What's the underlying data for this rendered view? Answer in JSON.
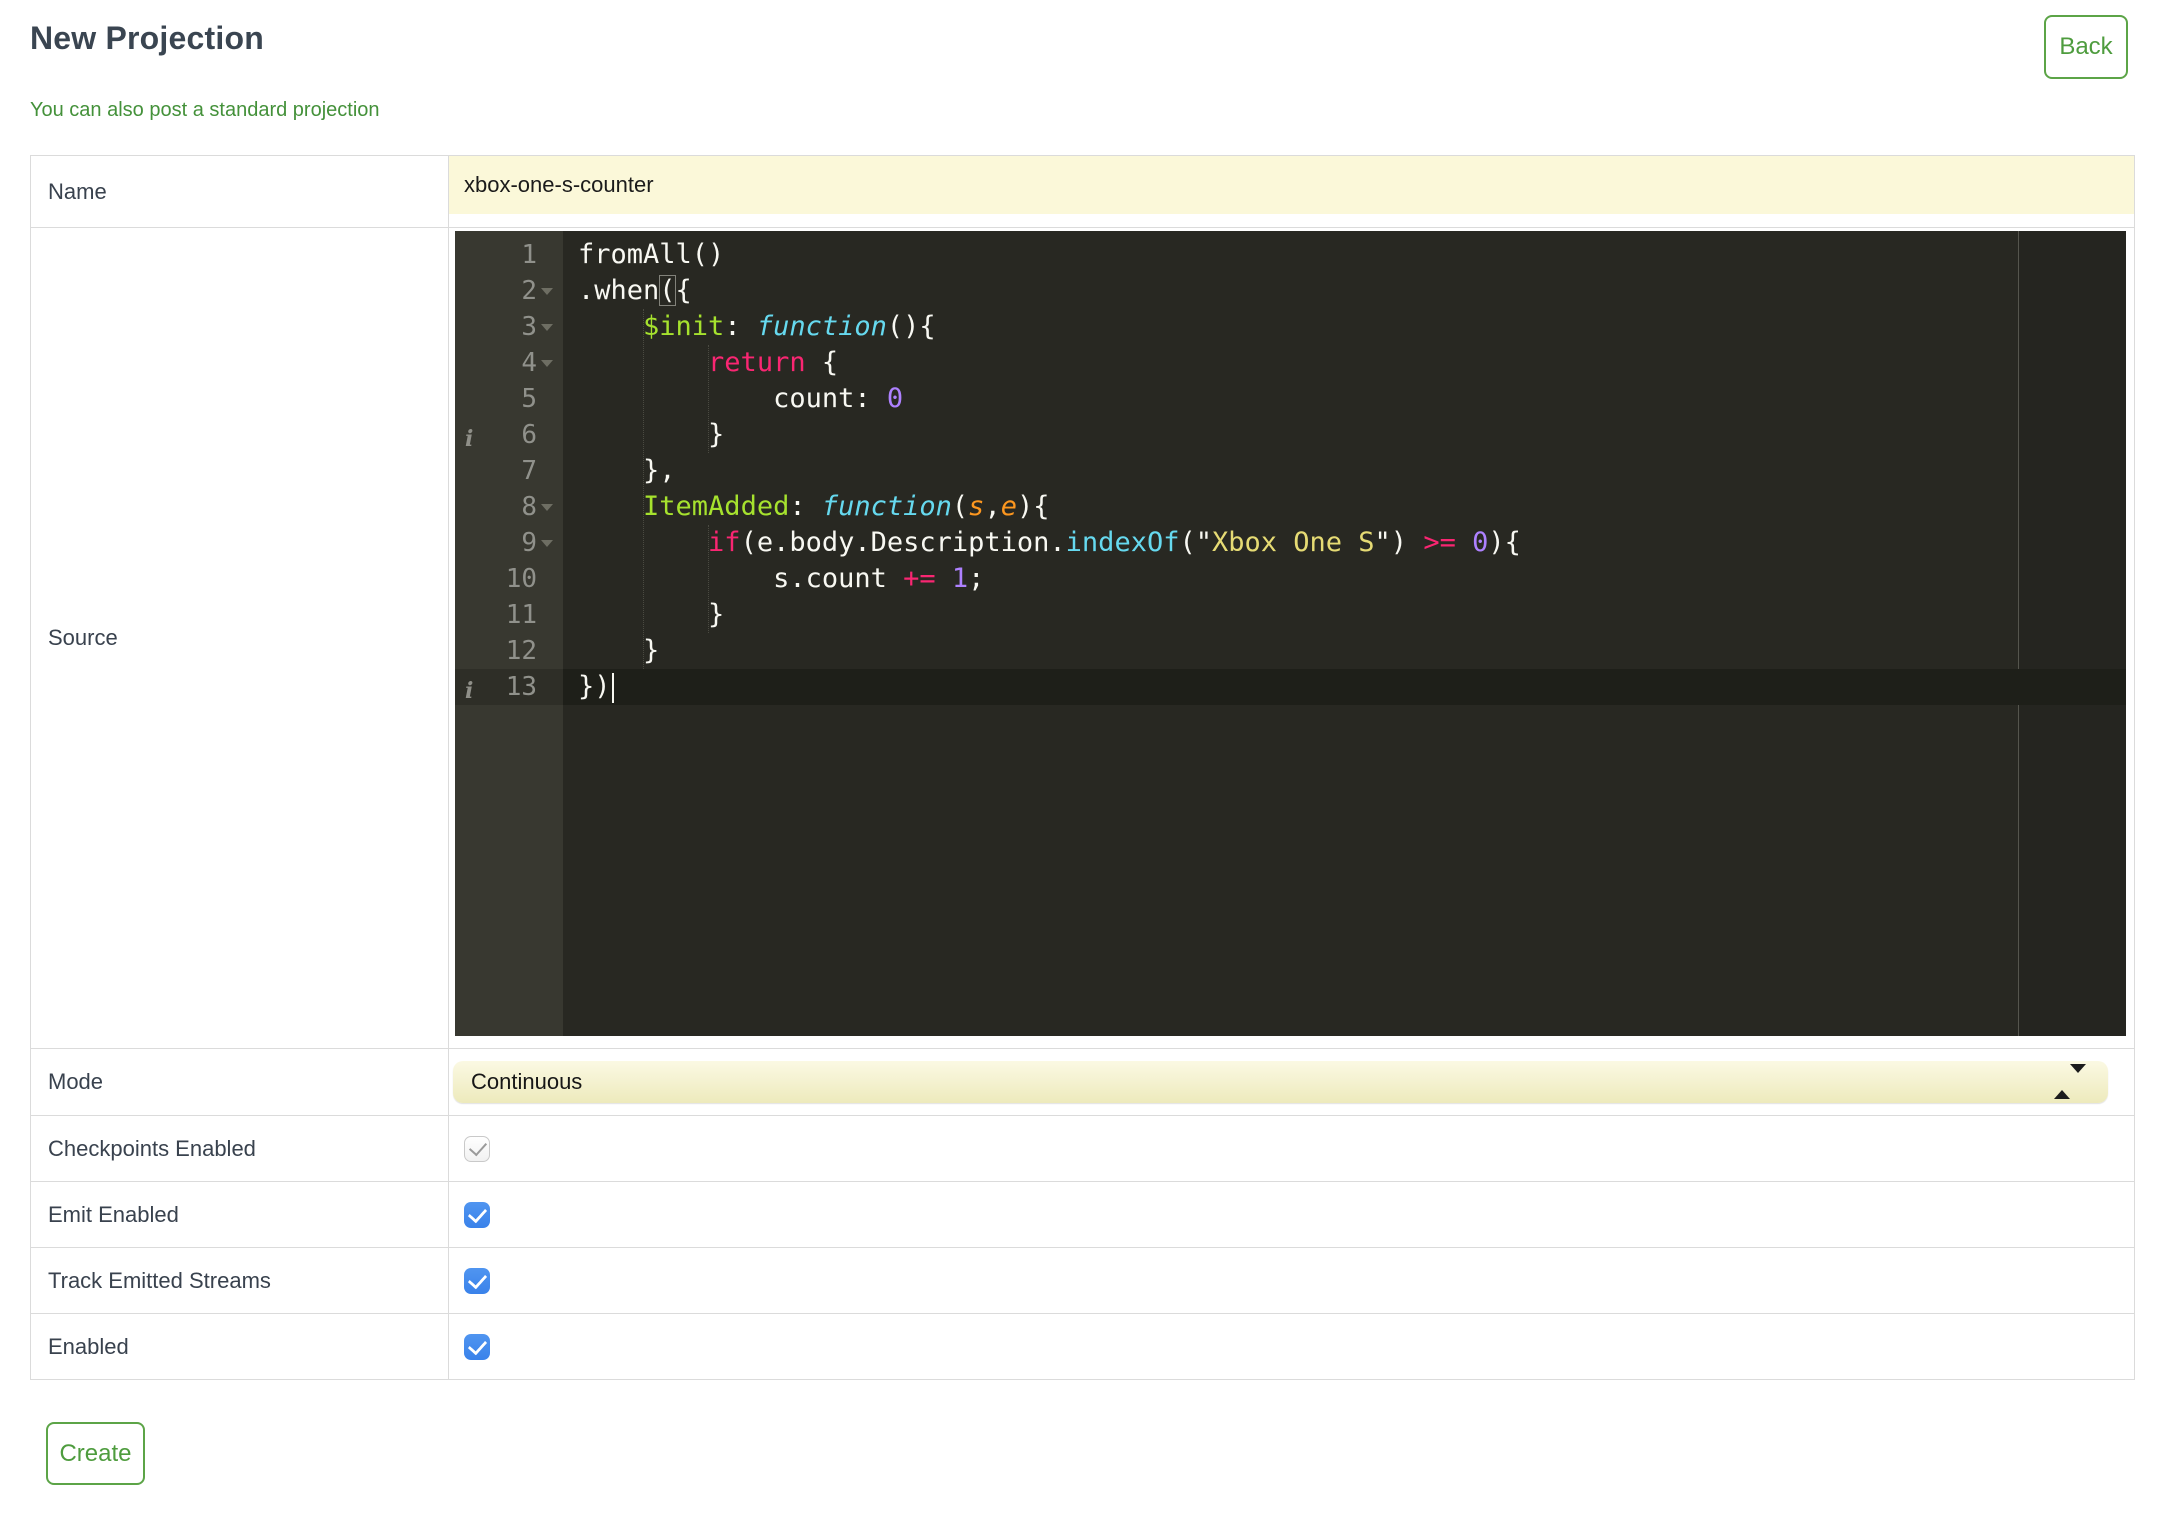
{
  "page": {
    "title": "New Projection",
    "back_label": "Back",
    "link_text": "You can also post a standard projection",
    "create_label": "Create"
  },
  "form": {
    "name": {
      "label": "Name",
      "value": "xbox-one-s-counter"
    },
    "source": {
      "label": "Source"
    },
    "mode": {
      "label": "Mode",
      "value": "Continuous"
    },
    "checkboxes": [
      {
        "label": "Checkpoints Enabled",
        "checked": true,
        "disabled": true
      },
      {
        "label": "Emit Enabled",
        "checked": true,
        "disabled": false
      },
      {
        "label": "Track Emitted Streams",
        "checked": true,
        "disabled": false
      },
      {
        "label": "Enabled",
        "checked": true,
        "disabled": false
      }
    ]
  },
  "editor": {
    "theme": {
      "background": "#282822",
      "gutter": "#383830",
      "text": "#F8F8F2",
      "keyword": "#F92672",
      "entity": "#A6E22E",
      "storage": "#66D9EF",
      "param": "#FD971F",
      "string": "#E6DB74",
      "number": "#AE81FF",
      "line_number": "#90918B"
    },
    "lines": [
      {
        "num": 1,
        "tokens": [
          [
            "t",
            "fromAll()"
          ]
        ]
      },
      {
        "num": 2,
        "fold": true,
        "tokens": [
          [
            "t",
            ".when"
          ],
          [
            "m",
            "("
          ],
          [
            "t",
            "{"
          ]
        ]
      },
      {
        "num": 3,
        "fold": true,
        "tokens": [
          [
            "t",
            "    "
          ],
          [
            "e",
            "$init"
          ],
          [
            "t",
            ": "
          ],
          [
            "s",
            "function"
          ],
          [
            "t",
            "(){"
          ]
        ]
      },
      {
        "num": 4,
        "fold": true,
        "tokens": [
          [
            "t",
            "        "
          ],
          [
            "k",
            "return"
          ],
          [
            "t",
            " {"
          ]
        ]
      },
      {
        "num": 5,
        "tokens": [
          [
            "t",
            "            count: "
          ],
          [
            "n",
            "0"
          ]
        ]
      },
      {
        "num": 6,
        "info": true,
        "tokens": [
          [
            "t",
            "        }"
          ]
        ]
      },
      {
        "num": 7,
        "tokens": [
          [
            "t",
            "    },"
          ]
        ]
      },
      {
        "num": 8,
        "fold": true,
        "tokens": [
          [
            "t",
            "    "
          ],
          [
            "e",
            "ItemAdded"
          ],
          [
            "t",
            ": "
          ],
          [
            "s",
            "function"
          ],
          [
            "t",
            "("
          ],
          [
            "p",
            "s"
          ],
          [
            "t",
            ","
          ],
          [
            "p",
            "e"
          ],
          [
            "t",
            "){"
          ]
        ]
      },
      {
        "num": 9,
        "fold": true,
        "tokens": [
          [
            "t",
            "        "
          ],
          [
            "k",
            "if"
          ],
          [
            "t",
            "(e.body.Description."
          ],
          [
            "f",
            "indexOf"
          ],
          [
            "t",
            "(\""
          ],
          [
            "str",
            "Xbox One S"
          ],
          [
            "t",
            "\") "
          ],
          [
            "k",
            ">="
          ],
          [
            "t",
            " "
          ],
          [
            "n",
            "0"
          ],
          [
            "t",
            "){"
          ]
        ]
      },
      {
        "num": 10,
        "tokens": [
          [
            "t",
            "            s.count "
          ],
          [
            "k",
            "+="
          ],
          [
            "t",
            " "
          ],
          [
            "n",
            "1"
          ],
          [
            "t",
            ";"
          ]
        ]
      },
      {
        "num": 11,
        "tokens": [
          [
            "t",
            "        }"
          ]
        ]
      },
      {
        "num": 12,
        "tokens": [
          [
            "t",
            "    }"
          ]
        ]
      },
      {
        "num": 13,
        "info": true,
        "active": true,
        "tokens": [
          [
            "t",
            "})"
          ],
          [
            "cur",
            ""
          ]
        ]
      }
    ]
  }
}
